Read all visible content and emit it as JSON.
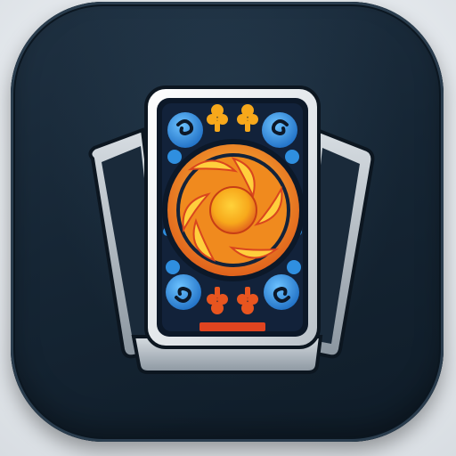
{
  "icon": {
    "name": "card-deck-app-icon",
    "colors": {
      "tile_background": "#162635",
      "card_face": "#0f1d33",
      "card_frame": "#f2f4f6",
      "card_shadow": "#8a949e",
      "ornament_blue": "#2f8fe0",
      "ornament_orange": "#f7a81b",
      "ornament_red": "#d9461e",
      "bottom_stripe": "#e04420"
    }
  }
}
